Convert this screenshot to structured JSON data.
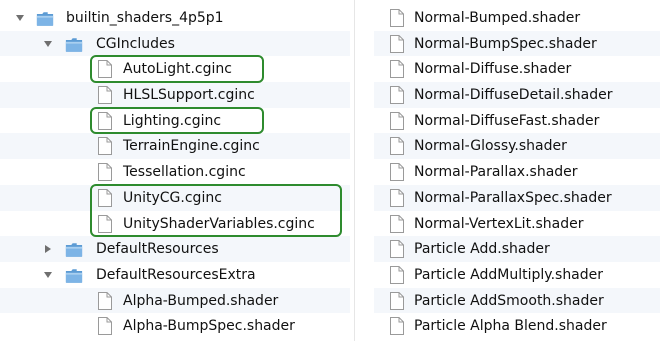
{
  "left_tree": [
    {
      "label": "builtin_shaders_4p5p1",
      "type": "folder",
      "depth": 0,
      "disclosure": "expanded",
      "highlight": false
    },
    {
      "label": "CGIncludes",
      "type": "folder",
      "depth": 1,
      "disclosure": "expanded",
      "highlight": false
    },
    {
      "label": "AutoLight.cginc",
      "type": "file",
      "depth": 2,
      "highlight": true
    },
    {
      "label": "HLSLSupport.cginc",
      "type": "file",
      "depth": 2,
      "highlight": false
    },
    {
      "label": "Lighting.cginc",
      "type": "file",
      "depth": 2,
      "highlight": true
    },
    {
      "label": "TerrainEngine.cginc",
      "type": "file",
      "depth": 2,
      "highlight": false
    },
    {
      "label": "Tessellation.cginc",
      "type": "file",
      "depth": 2,
      "highlight": false
    },
    {
      "label": "UnityCG.cginc",
      "type": "file",
      "depth": 2,
      "highlight": true
    },
    {
      "label": "UnityShaderVariables.cginc",
      "type": "file",
      "depth": 2,
      "highlight": true
    },
    {
      "label": "DefaultResources",
      "type": "folder",
      "depth": 1,
      "disclosure": "collapsed",
      "highlight": false
    },
    {
      "label": "DefaultResourcesExtra",
      "type": "folder",
      "depth": 1,
      "disclosure": "expanded",
      "highlight": false
    },
    {
      "label": "Alpha-Bumped.shader",
      "type": "file",
      "depth": 2,
      "highlight": false
    },
    {
      "label": "Alpha-BumpSpec.shader",
      "type": "file",
      "depth": 2,
      "highlight": false
    }
  ],
  "right_list": [
    "Normal-Bumped.shader",
    "Normal-BumpSpec.shader",
    "Normal-Diffuse.shader",
    "Normal-DiffuseDetail.shader",
    "Normal-DiffuseFast.shader",
    "Normal-Glossy.shader",
    "Normal-Parallax.shader",
    "Normal-ParallaxSpec.shader",
    "Normal-VertexLit.shader",
    "Particle Add.shader",
    "Particle AddMultiply.shader",
    "Particle AddSmooth.shader",
    "Particle Alpha Blend.shader"
  ],
  "colors": {
    "highlight_border": "#2e8b2e",
    "stripe": "#f4f7fb",
    "folder_fill": "#7db4e6",
    "folder_tab": "#5c9bd4"
  },
  "icons": {
    "folder": "folder-icon",
    "file": "document-icon",
    "expanded": "disclosure-expanded-icon",
    "collapsed": "disclosure-collapsed-icon"
  }
}
